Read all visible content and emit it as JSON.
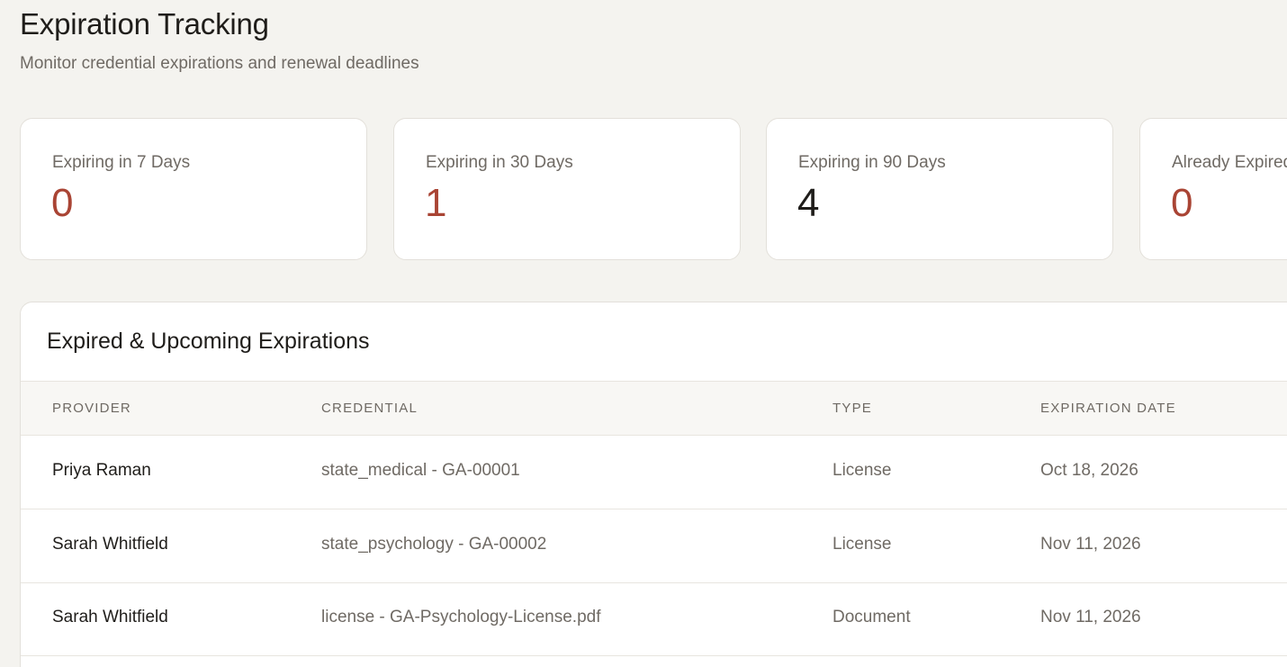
{
  "header": {
    "title": "Expiration Tracking",
    "subtitle": "Monitor credential expirations and renewal deadlines"
  },
  "stats": [
    {
      "label": "Expiring in 7 Days",
      "value": "0",
      "accent": "#a94434"
    },
    {
      "label": "Expiring in 30 Days",
      "value": "1",
      "accent": "#a94434"
    },
    {
      "label": "Expiring in 90 Days",
      "value": "4",
      "accent": "#1f1d1a"
    },
    {
      "label": "Already Expired",
      "value": "0",
      "accent": "#a94434"
    }
  ],
  "table": {
    "title": "Expired & Upcoming Expirations",
    "columns": [
      "Provider",
      "Credential",
      "Type",
      "Expiration Date"
    ],
    "rows": [
      {
        "provider": "Priya Raman",
        "credential": "state_medical - GA-00001",
        "type": "License",
        "expiration": "Oct 18, 2026"
      },
      {
        "provider": "Sarah Whitfield",
        "credential": "state_psychology - GA-00002",
        "type": "License",
        "expiration": "Nov 11, 2026"
      },
      {
        "provider": "Sarah Whitfield",
        "credential": "license - GA-Psychology-License.pdf",
        "type": "Document",
        "expiration": "Nov 11, 2026"
      }
    ]
  },
  "colors": {
    "background": "#f4f3ef",
    "alert": "#a94434",
    "text": "#1f1d1a",
    "muted": "#6f6a64"
  }
}
